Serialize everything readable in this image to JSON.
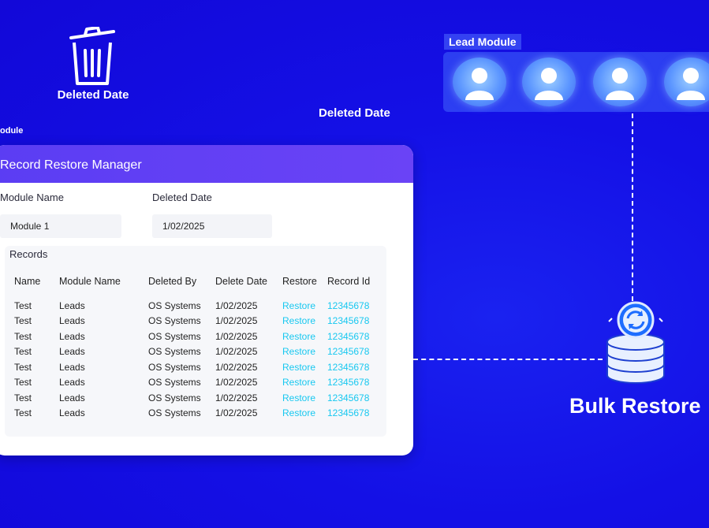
{
  "trash": {
    "label": "Deleted Date"
  },
  "floating_label": "Deleted Date",
  "module_fragment": "odule",
  "lead_module": {
    "title": "Lead Module",
    "avatars": [
      "user",
      "user",
      "user",
      "user"
    ]
  },
  "bulk_restore": {
    "label": "Bulk Restore"
  },
  "card": {
    "title": "Record Restore Manager",
    "module_name_label": "Module Name",
    "module_name_value": "Module 1",
    "deleted_date_label": "Deleted Date",
    "deleted_date_value": "1/02/2025",
    "records_label": "Records",
    "columns": [
      "Name",
      "Module Name",
      "Deleted By",
      "Delete Date",
      "Restore",
      "Record Id"
    ],
    "rows": [
      [
        "Test",
        "Leads",
        "OS Systems",
        "1/02/2025",
        "Restore",
        "12345678"
      ],
      [
        "Test",
        "Leads",
        "OS Systems",
        "1/02/2025",
        "Restore",
        "12345678"
      ],
      [
        "Test",
        "Leads",
        "OS Systems",
        "1/02/2025",
        "Restore",
        "12345678"
      ],
      [
        "Test",
        "Leads",
        "OS Systems",
        "1/02/2025",
        "Restore",
        "12345678"
      ],
      [
        "Test",
        "Leads",
        "OS Systems",
        "1/02/2025",
        "Restore",
        "12345678"
      ],
      [
        "Test",
        "Leads",
        "OS Systems",
        "1/02/2025",
        "Restore",
        "12345678"
      ],
      [
        "Test",
        "Leads",
        "OS Systems",
        "1/02/2025",
        "Restore",
        "12345678"
      ],
      [
        "Test",
        "Leads",
        "OS Systems",
        "1/02/2025",
        "Restore",
        "12345678"
      ]
    ]
  },
  "colors": {
    "background": "#1410e6",
    "header": "#5b3df3",
    "link": "#18c8f0",
    "panel": "#4a6eff"
  }
}
